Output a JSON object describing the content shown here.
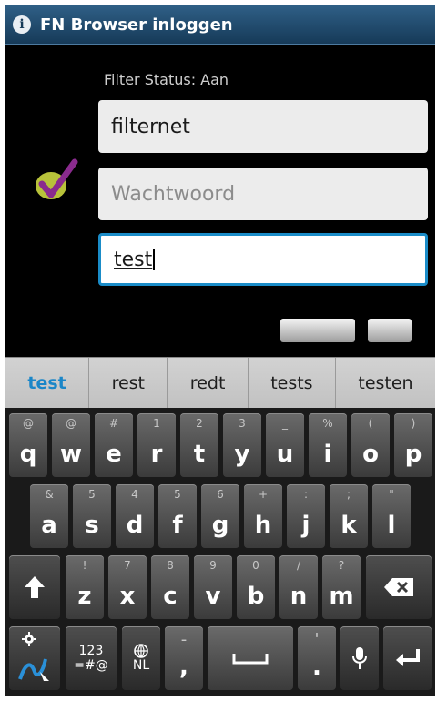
{
  "titlebar": {
    "title": "FN Browser inloggen"
  },
  "form": {
    "filter_status": "Filter Status: Aan",
    "username_value": "filternet",
    "password_placeholder": "Wachtwoord",
    "third_value": "test"
  },
  "suggestions": [
    "test",
    "rest",
    "redt",
    "tests",
    "testen"
  ],
  "keyboard": {
    "row1": [
      {
        "key": "q",
        "hint": "@"
      },
      {
        "key": "w",
        "hint": "@"
      },
      {
        "key": "e",
        "hint": "#"
      },
      {
        "key": "r",
        "hint": "1"
      },
      {
        "key": "t",
        "hint": "2"
      },
      {
        "key": "y",
        "hint": "3"
      },
      {
        "key": "u",
        "hint": "_"
      },
      {
        "key": "i",
        "hint": "%"
      },
      {
        "key": "o",
        "hint": "("
      },
      {
        "key": "p",
        "hint": ")"
      }
    ],
    "row2": [
      {
        "key": "a",
        "hint": "&"
      },
      {
        "key": "s",
        "hint": "5"
      },
      {
        "key": "d",
        "hint": "4"
      },
      {
        "key": "f",
        "hint": "5"
      },
      {
        "key": "g",
        "hint": "6"
      },
      {
        "key": "h",
        "hint": "+"
      },
      {
        "key": "j",
        "hint": ":"
      },
      {
        "key": "k",
        "hint": ";"
      },
      {
        "key": "l",
        "hint": "\""
      }
    ],
    "row3": [
      {
        "key": "z",
        "hint": "!"
      },
      {
        "key": "x",
        "hint": "7"
      },
      {
        "key": "c",
        "hint": "8"
      },
      {
        "key": "v",
        "hint": "9"
      },
      {
        "key": "b",
        "hint": "0"
      },
      {
        "key": "n",
        "hint": "/"
      },
      {
        "key": "m",
        "hint": "?"
      }
    ],
    "symbols_label_top": "123",
    "symbols_label_bottom": "=#@",
    "language_label": "NL",
    "comma_label": ",",
    "period_label": ".",
    "dash_label": "-",
    "apostrophe_label": "'"
  },
  "colors": {
    "accent": "#1a86c8",
    "titlebar": "#1f4a6e"
  }
}
